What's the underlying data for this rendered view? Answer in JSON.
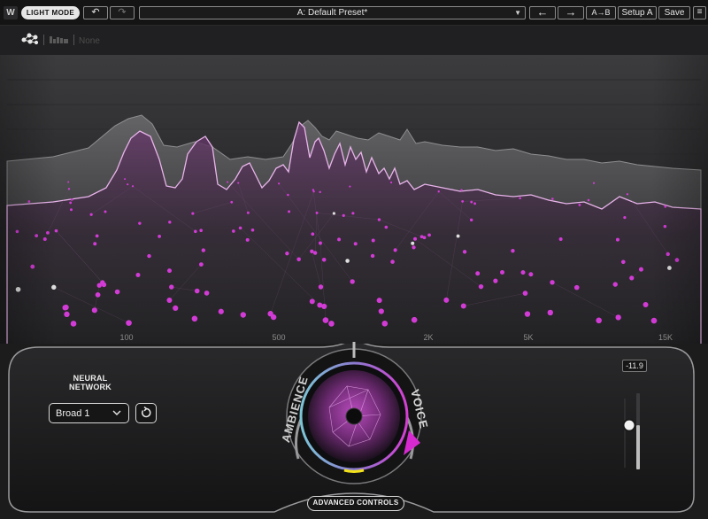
{
  "toolbar": {
    "logo": "W",
    "light_mode_label": "LIGHT MODE",
    "undo_icon": "undo-icon",
    "redo_icon": "redo-icon",
    "preset_name": "A: Default Preset*",
    "prev_icon": "arrow-left-icon",
    "next_icon": "arrow-right-icon",
    "ab_label": "A→B",
    "setup_label": "Setup A",
    "save_label": "Save",
    "menu_icon": "menu-icon"
  },
  "icon_row": {
    "none_label": "None"
  },
  "analyzer": {
    "freq_labels": [
      "100",
      "500",
      "2K",
      "5K",
      "15K"
    ]
  },
  "controls": {
    "neural_network_title": "NEURAL\nNETWORK",
    "neural_network_value": "Broad 1",
    "ambience_label": "AMBIENCE",
    "voice_label": "VOICE",
    "advanced_controls_label": "ADVANCED CONTROLS",
    "gain_value": "-11.9",
    "gain_level_fraction": 0.58
  },
  "colors": {
    "accent": "#d23bd6",
    "background": "#202022",
    "voice_arrow": "#d62ad0",
    "ambience_ring": "#6fc3d8",
    "yellow_marker": "#f3e21a"
  }
}
